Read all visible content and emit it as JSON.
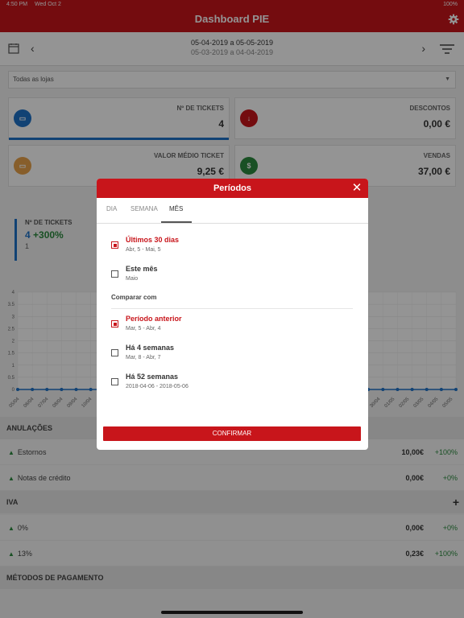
{
  "status": {
    "time": "4:50 PM",
    "date": "Wed Oct 2",
    "battery": "100%"
  },
  "nav": {
    "title": "Dashboard PIE"
  },
  "dates": {
    "current": "05-04-2019 a 05-05-2019",
    "previous": "05-03-2019 a 04-04-2019"
  },
  "store_select": {
    "value": "Todas as lojas"
  },
  "cards": [
    {
      "label": "Nº DE TICKETS",
      "value": "4",
      "icon": "ticket-icon",
      "color": "#1e72c8"
    },
    {
      "label": "DESCONTOS",
      "value": "0,00 €",
      "icon": "discount-icon",
      "color": "#c8151b"
    },
    {
      "label": "VALOR MÉDIO TICKET",
      "value": "9,25 €",
      "icon": "cash-icon",
      "color": "#e8a24a"
    },
    {
      "label": "VENDAS",
      "value": "37,00 €",
      "icon": "sales-icon",
      "color": "#2b8a3e"
    }
  ],
  "kpi": {
    "label": "Nº DE TICKETS",
    "value": "4",
    "change": "+300%",
    "previous": "1"
  },
  "chart_data": {
    "type": "line",
    "y_ticks": [
      "4",
      "3.5",
      "3",
      "2.5",
      "2",
      "1.5",
      "1",
      "0.5",
      "0"
    ],
    "x_left_labels": [
      "05/04",
      "06/04",
      "07/04",
      "08/04",
      "09/04",
      "10/04"
    ],
    "x_right_labels": [
      "30/04",
      "01/05",
      "02/05",
      "03/05",
      "04/05",
      "05/05"
    ],
    "ylim": [
      0,
      4
    ],
    "series_color": "#1e72c8"
  },
  "sections": {
    "anulacoes": "ANULAÇÕES",
    "iva": "IVA",
    "metodos": "MÉTODOS DE PAGAMENTO"
  },
  "rows": [
    {
      "label": "Estornos",
      "amount": "10,00€",
      "pct": "+100%"
    },
    {
      "label": "Notas de crédito",
      "amount": "0,00€",
      "pct": "+0%"
    },
    {
      "label": "0%",
      "amount": "0,00€",
      "pct": "+0%"
    },
    {
      "label": "13%",
      "amount": "0,23€",
      "pct": "+100%"
    }
  ],
  "modal": {
    "title": "Períodos",
    "tabs": [
      "DIA",
      "SEMANA",
      "MÊS"
    ],
    "active_tab": "MÊS",
    "options": [
      {
        "title": "Últimos 30 dias",
        "sub": "Abr, 5 - Mai, 5",
        "checked": true
      },
      {
        "title": "Este mês",
        "sub": "Maio",
        "checked": false
      }
    ],
    "compare_label": "Comparar com",
    "compare_options": [
      {
        "title": "Período anterior",
        "sub": "Mar, 5 - Abr, 4",
        "checked": true
      },
      {
        "title": "Há 4 semanas",
        "sub": "Mar, 8 - Abr, 7",
        "checked": false
      },
      {
        "title": "Há 52 semanas",
        "sub": "2018-04-06 - 2018-05-06",
        "checked": false
      }
    ],
    "confirm": "CONFIRMAR"
  }
}
